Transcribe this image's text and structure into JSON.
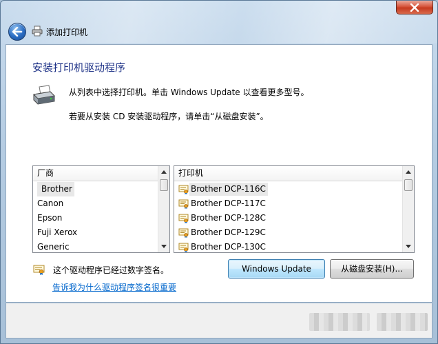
{
  "window": {
    "title": "添加打印机"
  },
  "content": {
    "heading": "安装打印机驱动程序",
    "desc_line1": "从列表中选择打印机。单击 Windows Update 以查看更多型号。",
    "desc_line2": "若要从安装 CD 安装驱动程序，请单击“从磁盘安装”。"
  },
  "manufacturer_list": {
    "header": "厂商",
    "items": [
      "Brother",
      "Canon",
      "Epson",
      "Fuji Xerox",
      "Generic"
    ],
    "selected": "Brother"
  },
  "printer_list": {
    "header": "打印机",
    "items": [
      "Brother DCP-116C",
      "Brother DCP-117C",
      "Brother DCP-128C",
      "Brother DCP-129C",
      "Brother DCP-130C"
    ],
    "selected": "Brother DCP-116C"
  },
  "signature": {
    "text": "这个驱动程序已经过数字签名。",
    "link": "告诉我为什么驱动程序签名很重要"
  },
  "buttons": {
    "windows_update": "Windows Update",
    "have_disk": "从磁盘安装(H)..."
  },
  "icons": {
    "back": "back-arrow-icon",
    "close": "close-icon",
    "printer": "printer-icon",
    "signature": "certificate-icon"
  },
  "colors": {
    "heading": "#1e3287",
    "link": "#0066cc"
  }
}
